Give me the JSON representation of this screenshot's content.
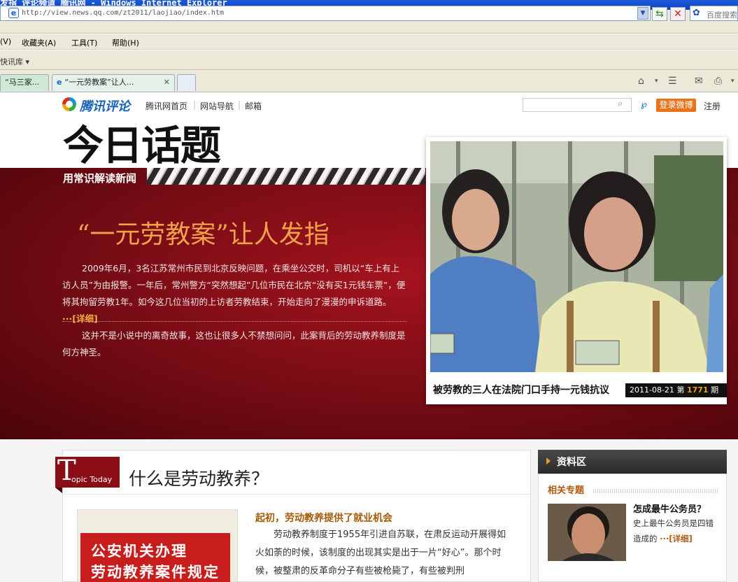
{
  "window": {
    "title": "发指_评论频道_腾讯网 - Windows Internet Explorer"
  },
  "browser": {
    "address": "http://view.news.qq.com/zt2011/laojiao/index.htm",
    "search_placeholder": "百度搜索",
    "menu": [
      "(V)",
      "收藏夹(A)",
      "工具(T)",
      "帮助(H)"
    ],
    "links_label": "快讯库 ▾",
    "tabs": [
      {
        "label": "“马三家..."
      },
      {
        "label": "“一元劳教案”让人..."
      }
    ]
  },
  "site": {
    "logo": "腾讯评论",
    "nav": [
      "腾讯网首页",
      "网站导航",
      "邮箱"
    ],
    "weibo_button": "登录微博",
    "register": "注册"
  },
  "hero": {
    "title": "今日话题",
    "subtitle": "用常识解读新闻",
    "headline": "“一元劳教案”让人发指",
    "para1": "2009年6月，3名江苏常州市民到北京反映问题，在乘坐公交时，司机以“车上有上访人员”为由报警。一年后，常州警方“突然想起”几位市民在北京“没有买1元钱车票”，便将其拘留劳教1年。如今这几位当初的上访者劳教结束，开始走向了漫漫的申诉道路。",
    "detail_link": "···[详细]",
    "para2": "这并不是小说中的离奇故事，这也让很多人不禁想问问，此案背后的劳动教养制度是何方神圣。",
    "photo_caption": "被劳教的三人在法院门口手持一元钱抗议",
    "date": "2011-08-21",
    "issue_prefix": "第",
    "issue_number": "1771",
    "issue_suffix": "期"
  },
  "topic": {
    "tag_letter": "T",
    "tag_rest": "opic Today",
    "title": "什么是劳动教养？",
    "book_line1": "公安机关办理",
    "book_line2": "劳动教养案件规定",
    "article_head": "起初，劳动教养提供了就业机会",
    "article_body": "劳动教养制度于1955年引进自苏联，在肃反运动开展得如火如荼的时候，该制度的出现其实是出于一片“好心”。那个时候，被整肃的反革命分子有些被枪毙了，有些被判刑"
  },
  "sidebar": {
    "title": "资料区",
    "related_label": "相关专题",
    "item_title": "怎成最牛公务员？",
    "item_desc": "史上最牛公务员是四错造成的",
    "item_detail": "···[详细]"
  }
}
